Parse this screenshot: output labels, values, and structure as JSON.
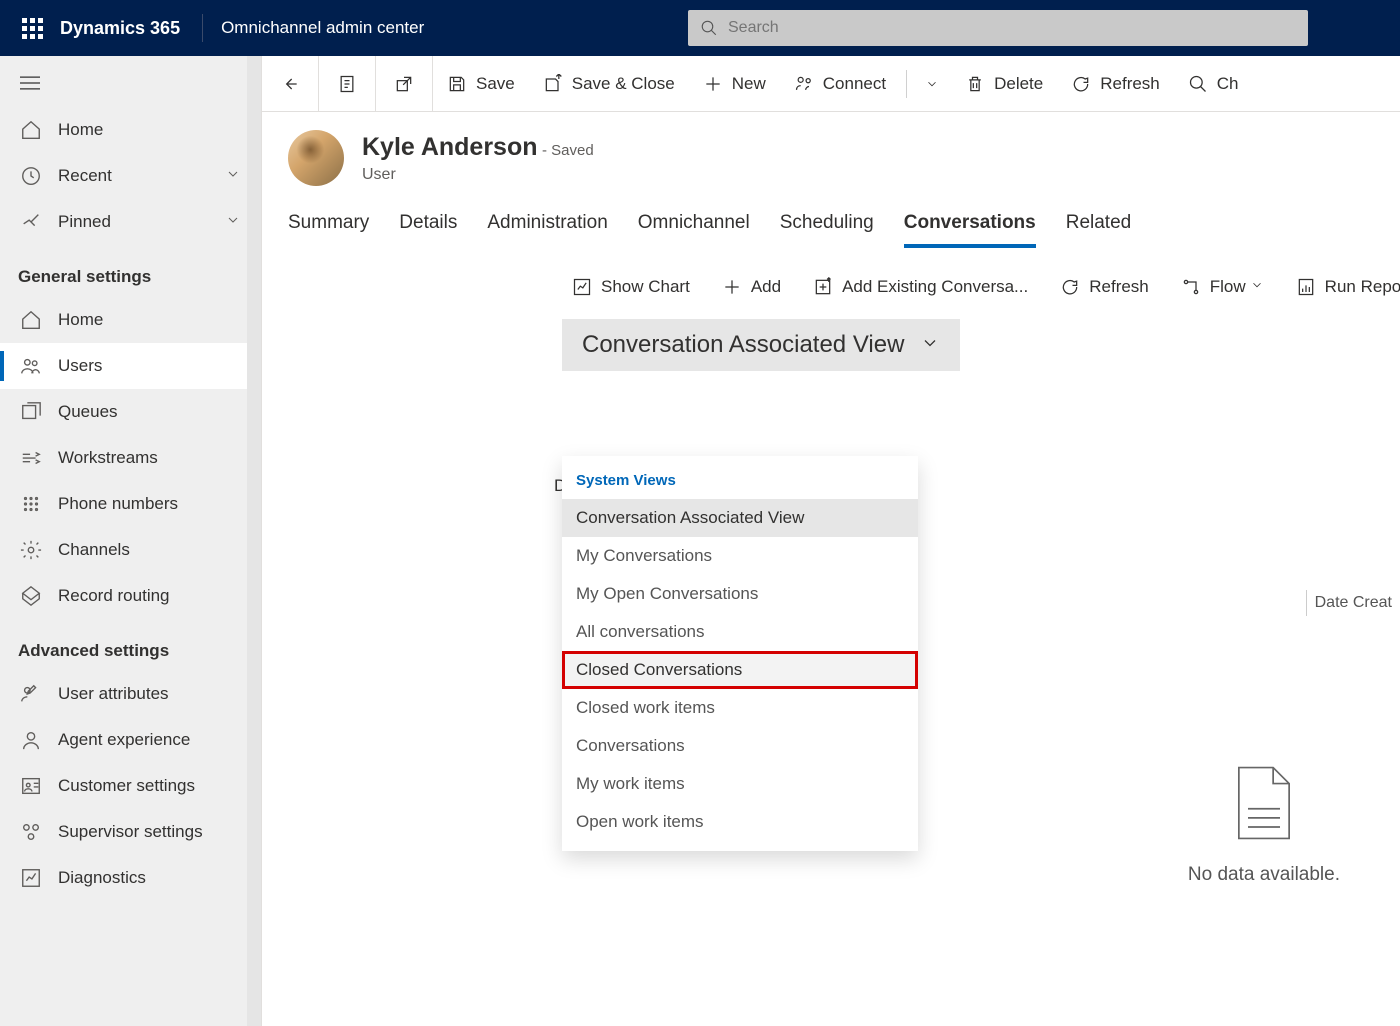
{
  "top": {
    "brand": "Dynamics 365",
    "app": "Omnichannel admin center",
    "search_placeholder": "Search"
  },
  "sidebar": {
    "home": "Home",
    "recent": "Recent",
    "pinned": "Pinned",
    "section1": "General settings",
    "items1": [
      "Home",
      "Users",
      "Queues",
      "Workstreams",
      "Phone numbers",
      "Channels",
      "Record routing"
    ],
    "section2": "Advanced settings",
    "items2": [
      "User attributes",
      "Agent experience",
      "Customer settings",
      "Supervisor settings",
      "Diagnostics"
    ]
  },
  "cmdbar": {
    "save": "Save",
    "saveclose": "Save & Close",
    "new": "New",
    "connect": "Connect",
    "delete": "Delete",
    "refresh": "Refresh",
    "ch": "Ch"
  },
  "record": {
    "name": "Kyle Anderson",
    "saved": "- Saved",
    "type": "User"
  },
  "tabs": [
    "Summary",
    "Details",
    "Administration",
    "Omnichannel",
    "Scheduling",
    "Conversations",
    "Related"
  ],
  "subcmd": {
    "chart": "Show Chart",
    "add": "Add",
    "addex": "Add Existing Conversa...",
    "refresh": "Refresh",
    "flow": "Flow",
    "run": "Run Report"
  },
  "view": {
    "current": "Conversation Associated View",
    "header": "System Views",
    "items": [
      "Conversation Associated View",
      "My Conversations",
      "My Open Conversations",
      "All conversations",
      "Closed Conversations",
      "Closed work items",
      "Conversations",
      "My work items",
      "Open work items"
    ]
  },
  "empty": "No data available.",
  "col": "Date Creat",
  "dletter": "D"
}
